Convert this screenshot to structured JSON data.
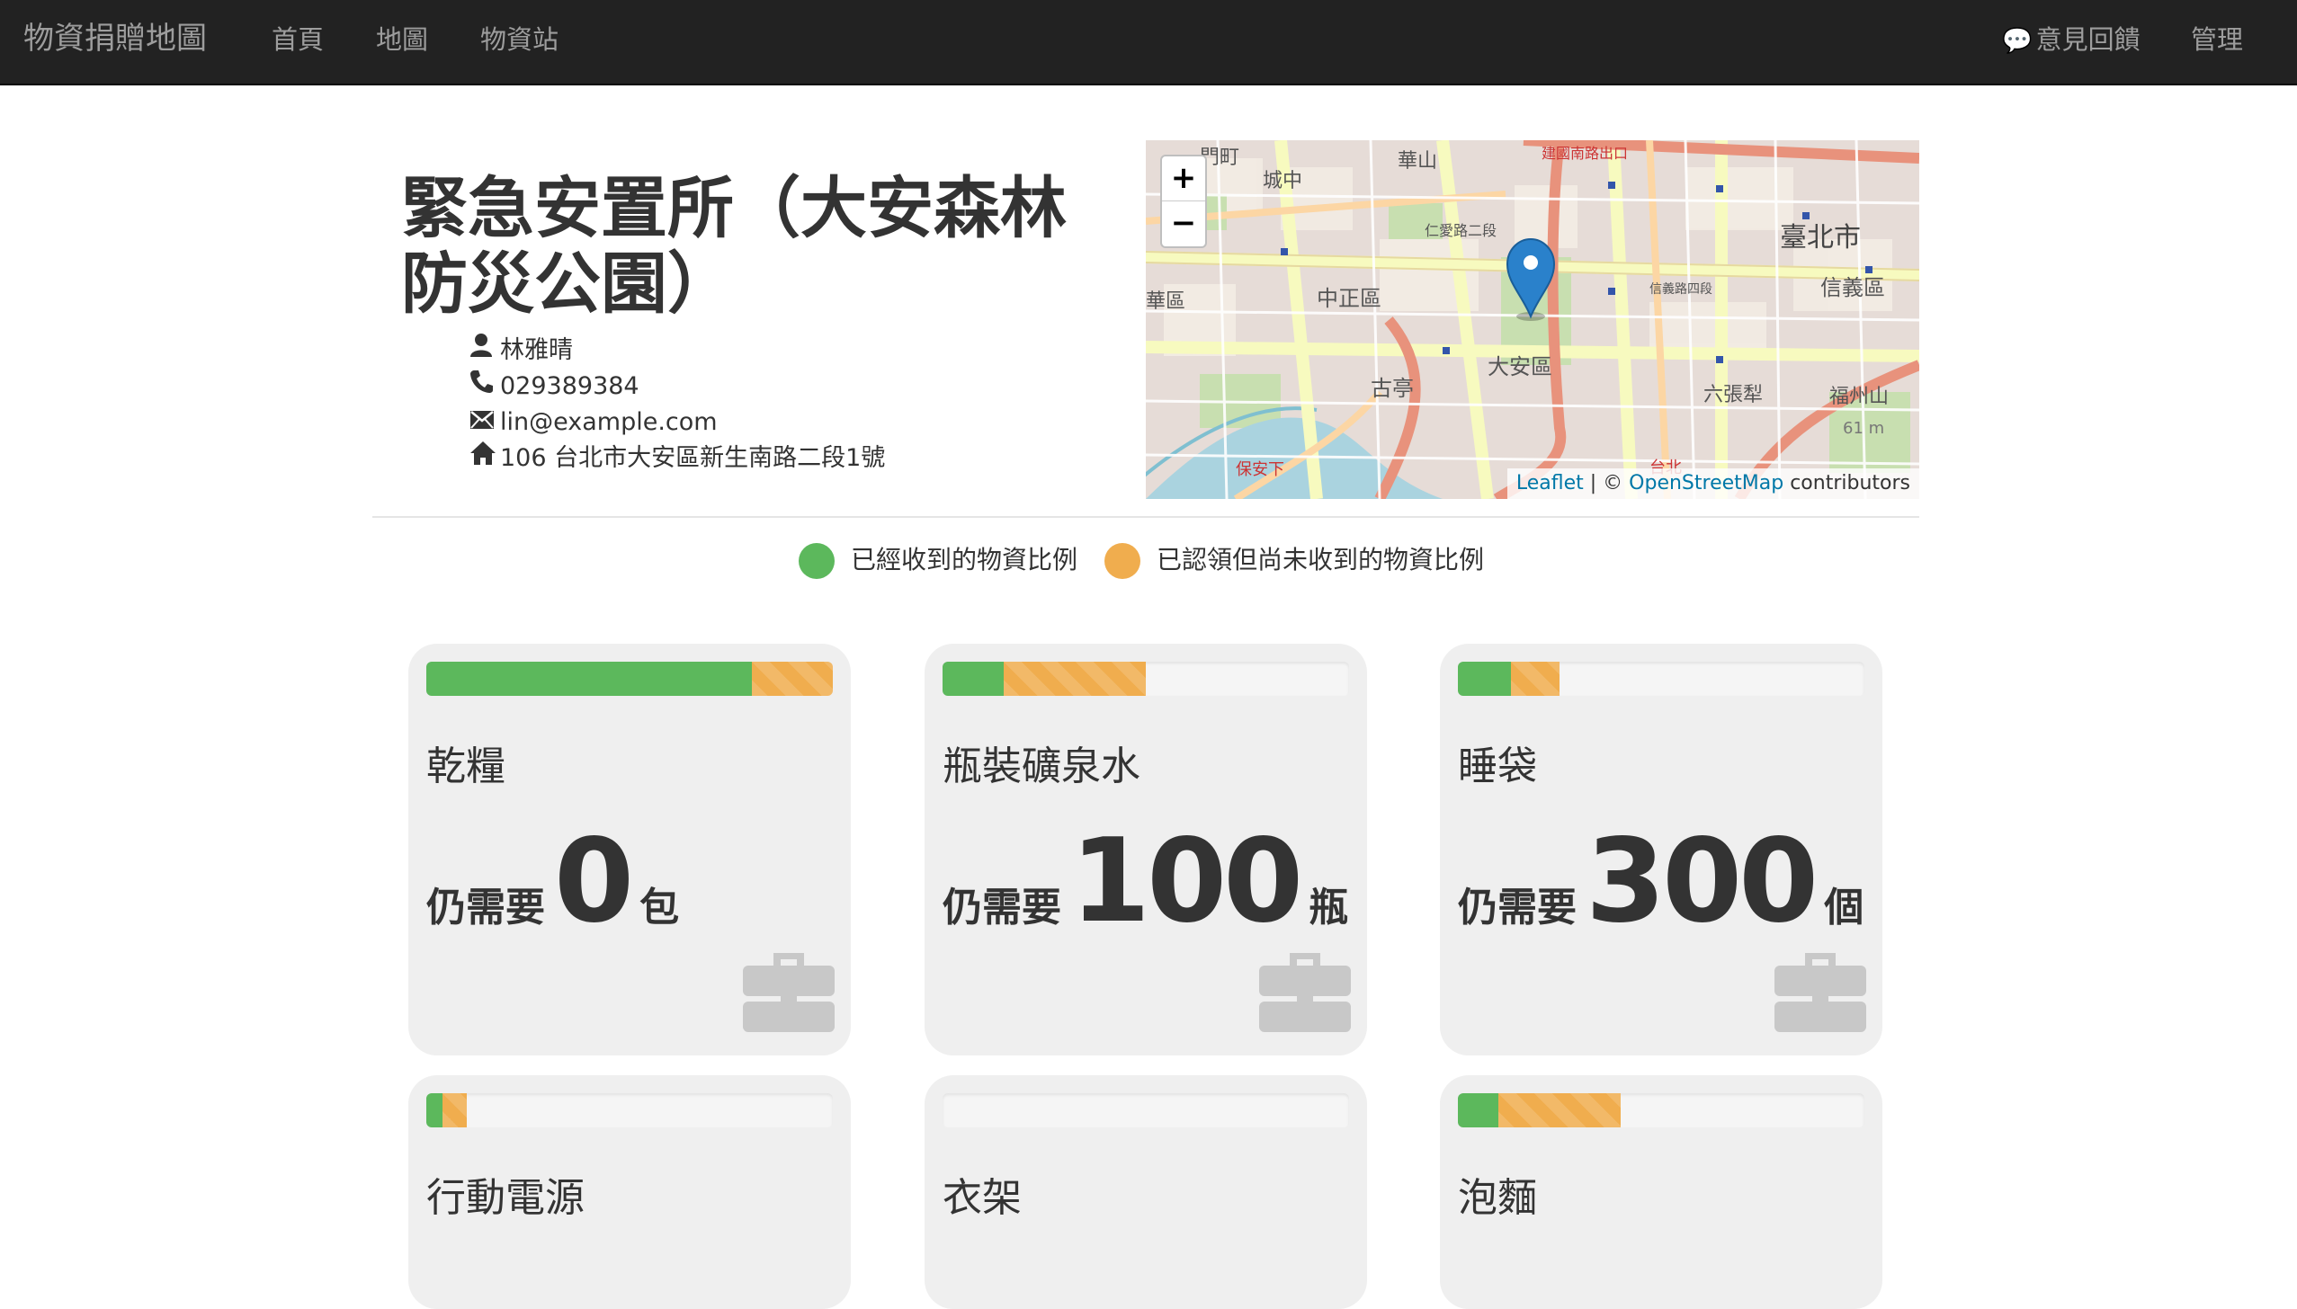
{
  "navbar": {
    "brand": "物資捐贈地圖",
    "links": [
      "首頁",
      "地圖",
      "物資站"
    ],
    "feedback_glyph": "💬",
    "feedback": "意見回饋",
    "admin": "管理"
  },
  "station": {
    "title": "緊急安置所（大安森林防災公園）",
    "contact_name": "林雅晴",
    "phone": "029389384",
    "email": "lin@example.com",
    "address": "106 台北市大安區新生南路二段1號"
  },
  "icons": {
    "user": "user-icon",
    "phone": "phone-icon",
    "email": "envelope-icon",
    "address": "home-icon",
    "item": "briefcase-icon"
  },
  "map": {
    "zoom_in": "+",
    "zoom_out": "−",
    "attribution_leaflet": "Leaflet",
    "attribution_sep": " | © ",
    "attribution_osm": "OpenStreetMap",
    "attribution_tail": " contributors",
    "labels": [
      "門町",
      "華山",
      "建國南路出口",
      "城中",
      "仁愛路二段",
      "臺北市",
      "信義路四段",
      "信義區",
      "中正區",
      "華區",
      "大安區",
      "古亭",
      "六張犁",
      "福州山",
      "61 m",
      "保安下",
      "台北"
    ]
  },
  "legend": {
    "received": "已經收到的物資比例",
    "claimed": "已認領但尚未收到的物資比例"
  },
  "colors": {
    "navbar": "#222222",
    "received": "#5cb85c",
    "claimed": "#f0ad4e",
    "card": "#efefef"
  },
  "need_label": "仍需要",
  "items": [
    {
      "name": "乾糧",
      "need": "0",
      "unit": "包",
      "received_pct": 80,
      "claimed_pct": 20
    },
    {
      "name": "瓶裝礦泉水",
      "need": "100",
      "unit": "瓶",
      "received_pct": 15,
      "claimed_pct": 35
    },
    {
      "name": "睡袋",
      "need": "300",
      "unit": "個",
      "received_pct": 13,
      "claimed_pct": 12
    },
    {
      "name": "行動電源",
      "need": "",
      "unit": "",
      "received_pct": 4,
      "claimed_pct": 6
    },
    {
      "name": "衣架",
      "need": "",
      "unit": "",
      "received_pct": 0,
      "claimed_pct": 0
    },
    {
      "name": "泡麵",
      "need": "",
      "unit": "",
      "received_pct": 10,
      "claimed_pct": 30
    }
  ]
}
